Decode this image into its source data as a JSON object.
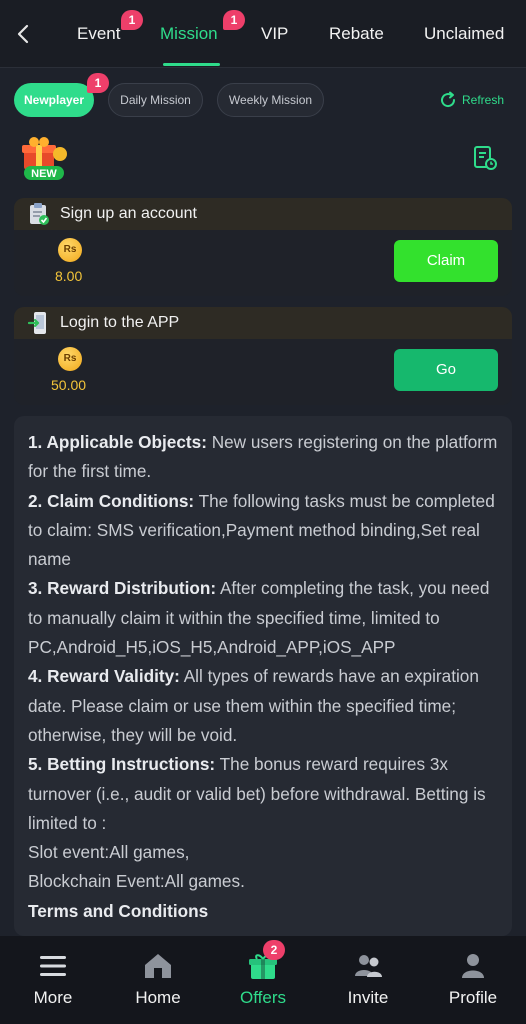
{
  "top_nav": {
    "tabs": [
      {
        "label": "Event",
        "badge": "1"
      },
      {
        "label": "Mission",
        "badge": "1",
        "active": true
      },
      {
        "label": "VIP"
      },
      {
        "label": "Rebate"
      },
      {
        "label": "Unclaimed"
      }
    ]
  },
  "filters": {
    "chips": [
      {
        "label": "Newplayer",
        "badge": "1",
        "active": true
      },
      {
        "label": "Daily Mission"
      },
      {
        "label": "Weekly Mission"
      }
    ],
    "refresh_label": "Refresh"
  },
  "gift": {
    "new_label": "NEW"
  },
  "tasks": [
    {
      "title": "Sign up an account",
      "currency": "Rs",
      "amount": "8.00",
      "action": "Claim",
      "icon": "clipboard-check-icon"
    },
    {
      "title": "Login to the APP",
      "currency": "Rs",
      "amount": "50.00",
      "action": "Go",
      "icon": "phone-app-icon"
    }
  ],
  "rules": {
    "r1_title": "1. Applicable Objects:",
    "r1_text": " New users registering on the platform for the first time.",
    "r2_title": "2. Claim Conditions:",
    "r2_text": " The following tasks must be completed to claim: SMS verification,Payment method binding,Set real name",
    "r3_title": "3. Reward Distribution:",
    "r3_text": " After completing the task, you need to manually claim it within the specified time, limited to PC,Android_H5,iOS_H5,Android_APP,iOS_APP",
    "r4_title": "4. Reward Validity:",
    "r4_text": " All types of rewards have an expiration date. Please claim or use them within the specified time; otherwise, they will be void.",
    "r5_title": "5. Betting Instructions:",
    "r5_text": " The bonus reward requires 3x turnover (i.e., audit or valid bet) before withdrawal. Betting is limited to :",
    "slot": "Slot event:All games,",
    "blockchain": "Blockchain Event:All games.",
    "terms": "Terms and Conditions"
  },
  "bottom_nav": {
    "items": [
      {
        "label": "More",
        "icon": "menu-icon"
      },
      {
        "label": "Home",
        "icon": "home-icon"
      },
      {
        "label": "Offers",
        "icon": "gift-icon",
        "badge": "2",
        "active": true
      },
      {
        "label": "Invite",
        "icon": "users-icon"
      },
      {
        "label": "Profile",
        "icon": "profile-icon"
      }
    ]
  },
  "colors": {
    "accent": "#2fdc8b",
    "badge": "#ee3f6a",
    "claim": "#33e12d",
    "go": "#16b86d",
    "amount": "#f3c53a"
  }
}
